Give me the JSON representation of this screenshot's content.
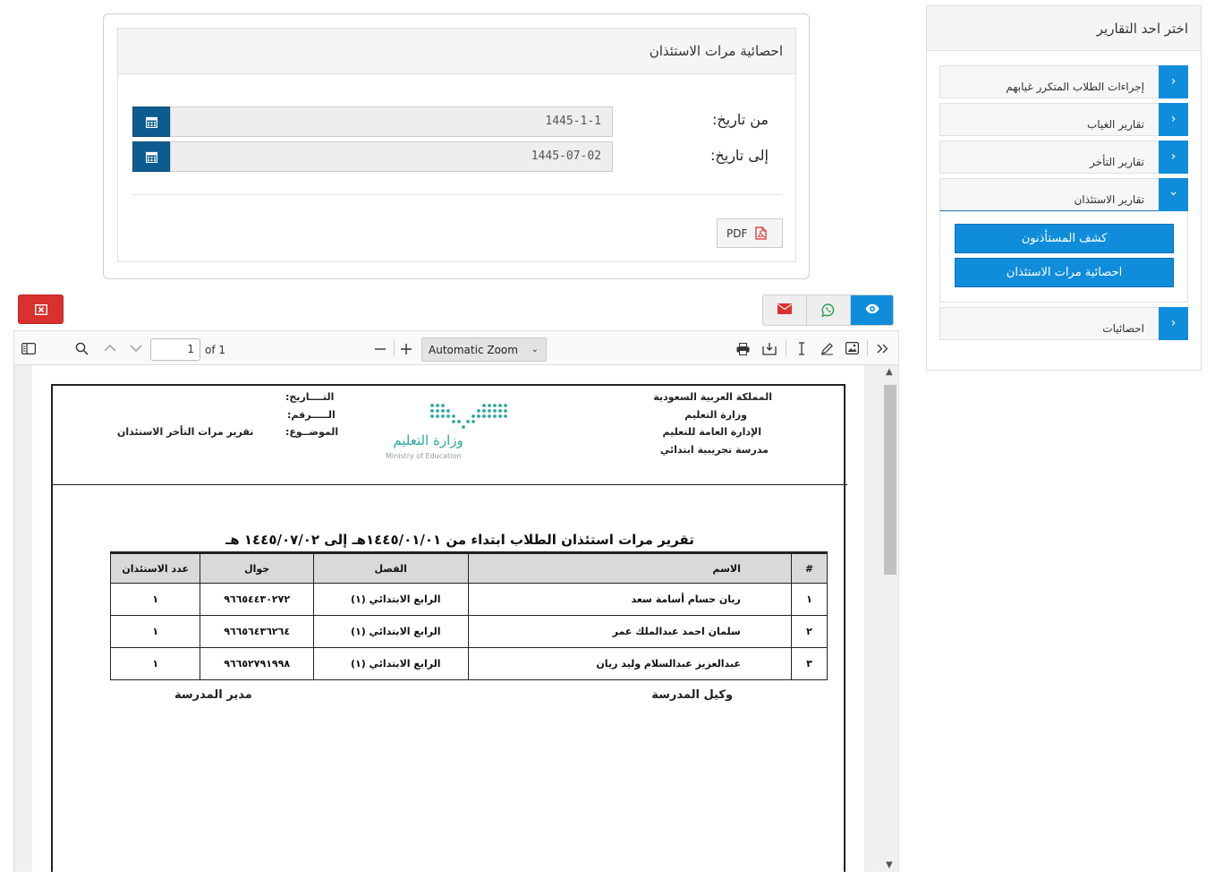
{
  "sidebar": {
    "title": "اختر احد التقارير",
    "items": [
      {
        "label": "إجراءات الطلاب المتكرر غيابهم",
        "arrow": "›"
      },
      {
        "label": "تقارير الغياب",
        "arrow": "›"
      },
      {
        "label": "تقارير التأخر",
        "arrow": "›"
      },
      {
        "label": "تقارير الاستئذان",
        "arrow": "⌄"
      },
      {
        "label": "احصائيات",
        "arrow": "›"
      }
    ],
    "sub_buttons": [
      "كشف المستأذنون",
      "احصائية مرات الاستئذان"
    ]
  },
  "form": {
    "title": "احصائية مرات الاستئذان",
    "from_label": "من تاريخ:",
    "from_value": "1445-1-1",
    "to_label": "إلى تاريخ:",
    "to_value": "1445-07-02",
    "pdf_label": "PDF"
  },
  "toolbar": {
    "page_number": "1",
    "page_total": "of 1",
    "zoom": "Automatic Zoom"
  },
  "doc": {
    "right_header": [
      "المملكة العربية السعودية",
      "وزارة التعليم",
      "الإدارة العامة للتعليم",
      "مدرسة تجريبية ابتدائي"
    ],
    "logo_ar": "وزارة التعليم",
    "logo_en": "Ministry of Education",
    "meta_labels": [
      "التــــاريخ:",
      "الـــــرقم:",
      "الموضــوع:"
    ],
    "subject": "تقرير مرات التأخر الاستئذان",
    "title": "تقرير مرات استئذان الطلاب ابتداء من ١٤٤٥/٠١/٠١هـ إلى ١٤٤٥/٠٧/٠٢ هـ",
    "table": {
      "headers": [
        "#",
        "الاسم",
        "الفصل",
        "جوال",
        "عدد الاستئذان"
      ],
      "rows": [
        [
          "١",
          "ريان حسام أسامة سعد",
          "الرابع الابتدائي (١)",
          "٩٦٦٥٤٤٣٠٢٧٢",
          "١"
        ],
        [
          "٢",
          "سلمان احمد عبدالملك عمر",
          "الرابع الابتدائي (١)",
          "٩٦٦٥٦٤٣٦٢٦٤",
          "١"
        ],
        [
          "٣",
          "عبدالعزيز عبدالسلام وليد ريان",
          "الرابع الابتدائي (١)",
          "٩٦٦٥٢٧٩١٩٩٨",
          "١"
        ]
      ]
    },
    "sig_right": "وكيل المدرسة",
    "sig_left": "مدير المدرسة"
  },
  "colors": {
    "primary": "#0f8ddb",
    "dark_blue": "#0d5c8f",
    "danger": "#d9312f",
    "logo_teal": "#2fa8a0"
  }
}
